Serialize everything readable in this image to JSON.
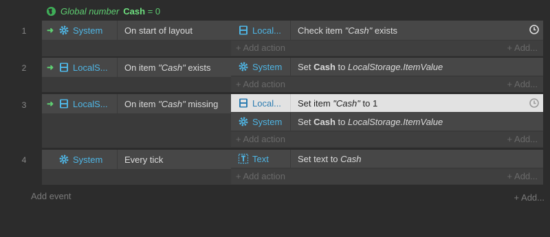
{
  "global_var": {
    "prefix": "Global number",
    "name": "Cash",
    "suffix": "= 0"
  },
  "events": [
    {
      "number": "1",
      "condition": {
        "object": "System",
        "icon": "gear-icon",
        "text_plain": "On start of layout"
      },
      "actions": [
        {
          "object": "Local...",
          "icon": "localstorage-icon",
          "pre": "Check item ",
          "italic": "\"Cash\"",
          "post": " exists",
          "clock": true
        }
      ],
      "add_action": "+ Add action",
      "add_more": "+ Add..."
    },
    {
      "number": "2",
      "condition": {
        "object": "LocalS...",
        "icon": "localstorage-icon",
        "pre": "On item ",
        "italic": "\"Cash\"",
        "post": " exists"
      },
      "actions": [
        {
          "object": "System",
          "icon": "gear-icon",
          "pre": "Set ",
          "bold": "Cash",
          "mid": " to ",
          "italic2": "LocalStorage.ItemValue"
        }
      ],
      "add_action": "+ Add action",
      "add_more": "+ Add..."
    },
    {
      "number": "3",
      "condition": {
        "object": "LocalS...",
        "icon": "localstorage-icon",
        "pre": "On item ",
        "italic": "\"Cash\"",
        "post": " missing"
      },
      "actions": [
        {
          "object": "Local...",
          "icon": "localstorage-icon",
          "pre": "Set item ",
          "italic": "\"Cash\"",
          "post": " to 1",
          "clock": true,
          "selected": true
        },
        {
          "object": "System",
          "icon": "gear-icon",
          "pre": "Set ",
          "bold": "Cash",
          "mid": " to ",
          "italic2": "LocalStorage.ItemValue"
        }
      ],
      "add_action": "+ Add action",
      "add_more": "+ Add..."
    },
    {
      "number": "4",
      "condition": {
        "object": "System",
        "icon": "gear-icon",
        "text_plain": "Every tick"
      },
      "actions": [
        {
          "object": "Text",
          "icon": "text-object-icon",
          "pre": "Set text to ",
          "italic2": "Cash"
        }
      ],
      "add_action": "+ Add action",
      "add_more": "+ Add..."
    }
  ],
  "footer": {
    "add_event": "Add event",
    "add_more": "+ Add..."
  },
  "colors": {
    "accent_green": "#5fcf72",
    "object_blue": "#4fb6e5",
    "selected_bg": "#e2e2e2"
  }
}
